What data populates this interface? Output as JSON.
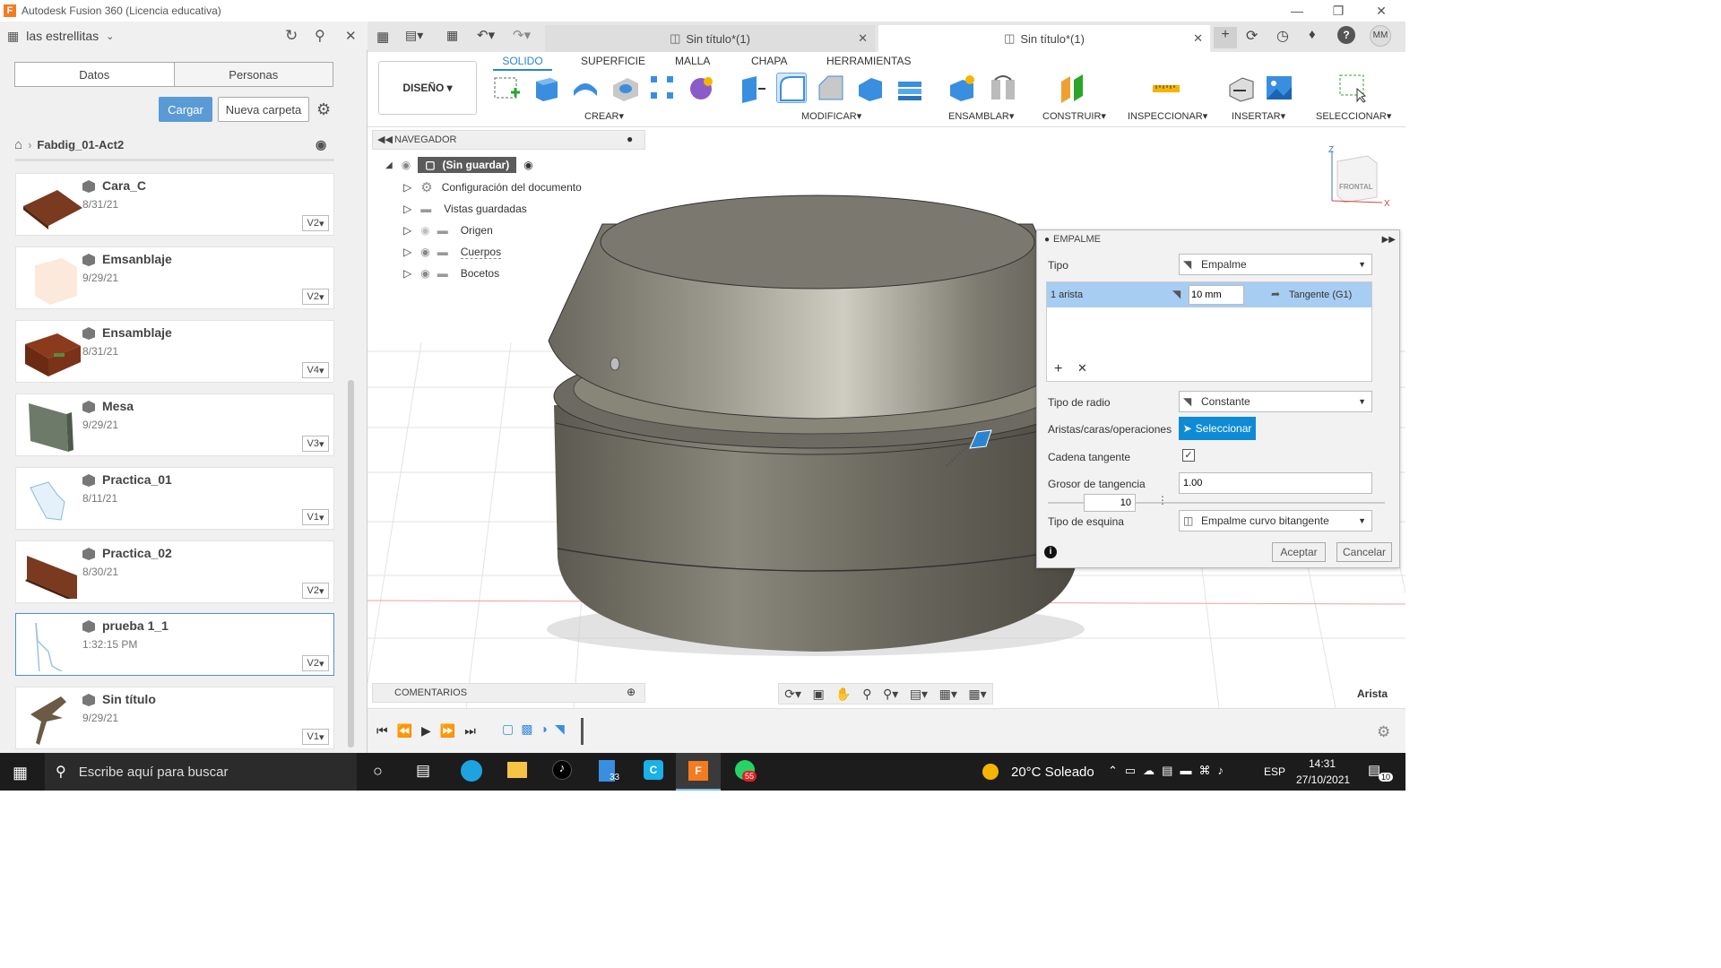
{
  "window": {
    "title": "Autodesk Fusion 360 (Licencia educativa)",
    "logo": "F"
  },
  "left_panel": {
    "project": "las estrellitas",
    "tabs": [
      "Datos",
      "Personas"
    ],
    "upload": "Cargar",
    "new_folder": "Nueva carpeta",
    "breadcrumb": "Fabdig_01-Act2",
    "files": [
      {
        "name": "Cara_C",
        "date": "8/31/21",
        "version": "V2"
      },
      {
        "name": "Emsanblaje",
        "date": "9/29/21",
        "version": "V2"
      },
      {
        "name": "Ensamblaje",
        "date": "8/31/21",
        "version": "V4"
      },
      {
        "name": "Mesa",
        "date": "9/29/21",
        "version": "V3"
      },
      {
        "name": "Practica_01",
        "date": "8/11/21",
        "version": "V1"
      },
      {
        "name": "Practica_02",
        "date": "8/30/21",
        "version": "V2"
      },
      {
        "name": "prueba 1_1",
        "date": "1:32:15 PM",
        "version": "V2"
      },
      {
        "name": "Sin título",
        "date": "9/29/21",
        "version": "V1"
      }
    ]
  },
  "doc_tabs": [
    "Sin título*(1)",
    "Sin título*(1)"
  ],
  "user_initials": "MM",
  "ribbon": {
    "workspace": "DISEÑO",
    "tabs": [
      "SOLIDO",
      "SUPERFICIE",
      "MALLA",
      "CHAPA",
      "HERRAMIENTAS"
    ],
    "groups": [
      "CREAR",
      "MODIFICAR",
      "ENSAMBLAR",
      "CONSTRUIR",
      "INSPECCIONAR",
      "INSERTAR",
      "SELECCIONAR"
    ]
  },
  "navigator": {
    "title": "NAVEGADOR",
    "root": "(Sin guardar)",
    "items": [
      "Configuración del documento",
      "Vistas guardadas",
      "Origen",
      "Cuerpos",
      "Bocetos"
    ]
  },
  "comments": "COMENTARIOS",
  "viewcube": {
    "face": "FRONTAL",
    "z": "Z",
    "x": "X"
  },
  "status_selection": "Arista",
  "dialog": {
    "title": "EMPALME",
    "tipo_label": "Tipo",
    "tipo_value": "Empalme",
    "edge_count": "1 arista",
    "radius": "10 mm",
    "continuity": "Tangente (G1)",
    "radius_type_label": "Tipo de radio",
    "radius_type": "Constante",
    "edges_label": "Aristas/caras/operaciones",
    "select_btn": "Seleccionar",
    "chain_label": "Cadena tangente",
    "tangency_label": "Grosor de tangencia",
    "tangency_value": "1.00",
    "slider_value": "10",
    "corner_label": "Tipo de esquina",
    "corner_value": "Empalme curvo bitangente",
    "ok": "Aceptar",
    "cancel": "Cancelar"
  },
  "taskbar": {
    "search": "Escribe aquí para buscar",
    "weather": "20°C Soleado",
    "lang": "ESP",
    "time": "14:31",
    "date": "27/10/2021",
    "badge_33": "33",
    "badge_55": "55",
    "notif": "10"
  }
}
